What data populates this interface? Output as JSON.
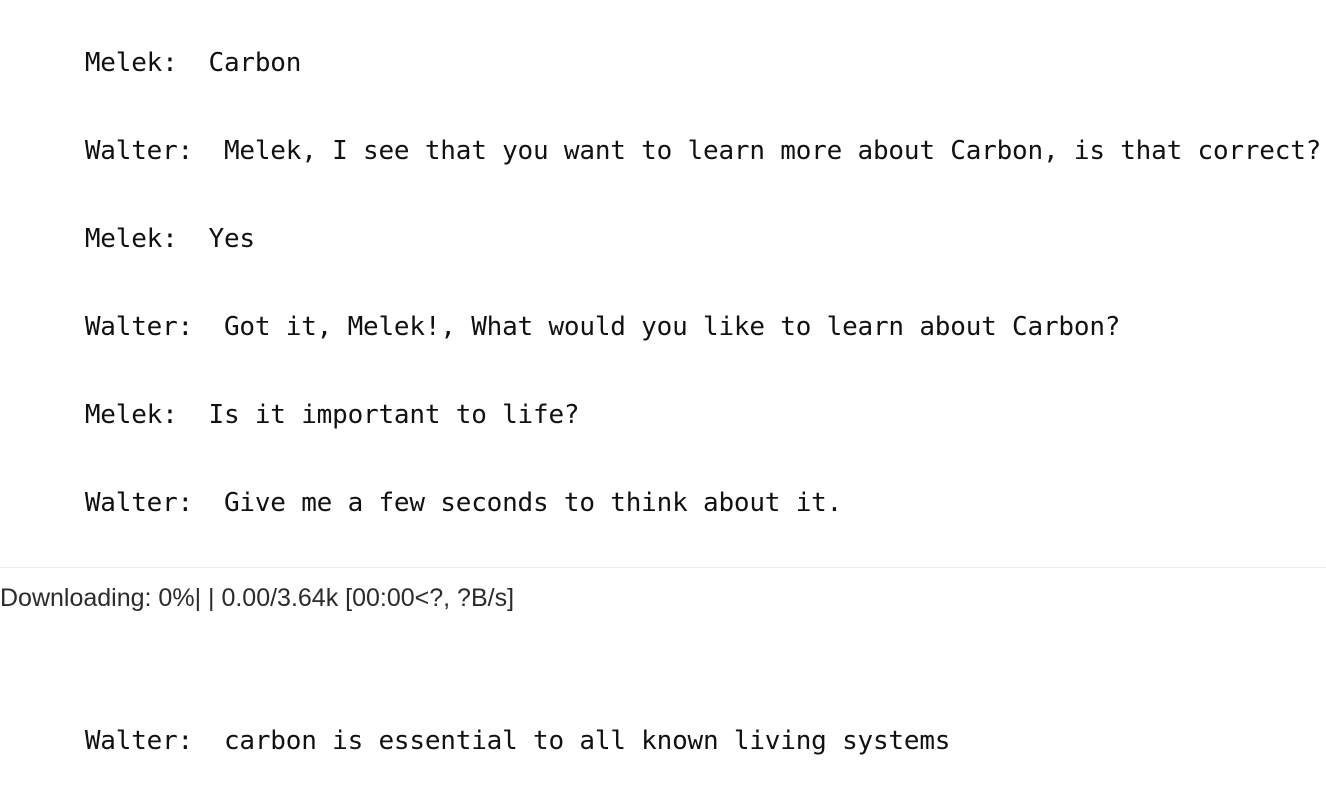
{
  "transcript": [
    {
      "speaker": "Melek:",
      "text": "Carbon"
    },
    {
      "speaker": "Walter:",
      "text": "Melek, I see that you want to learn more about Carbon, is that correct?"
    },
    {
      "speaker": "Melek:",
      "text": "Yes"
    },
    {
      "speaker": "Walter:",
      "text": "Got it, Melek!, What would you like to learn about Carbon?"
    },
    {
      "speaker": "Melek:",
      "text": "Is it important to life?"
    },
    {
      "speaker": "Walter:",
      "text": "Give me a few seconds to think about it."
    }
  ],
  "progress": {
    "text": "Downloading: 0%| | 0.00/3.64k [00:00<?, ?B/s]",
    "percent": 0
  },
  "result": {
    "speaker": "Walter:",
    "text": "carbon is essential to all known living systems"
  }
}
